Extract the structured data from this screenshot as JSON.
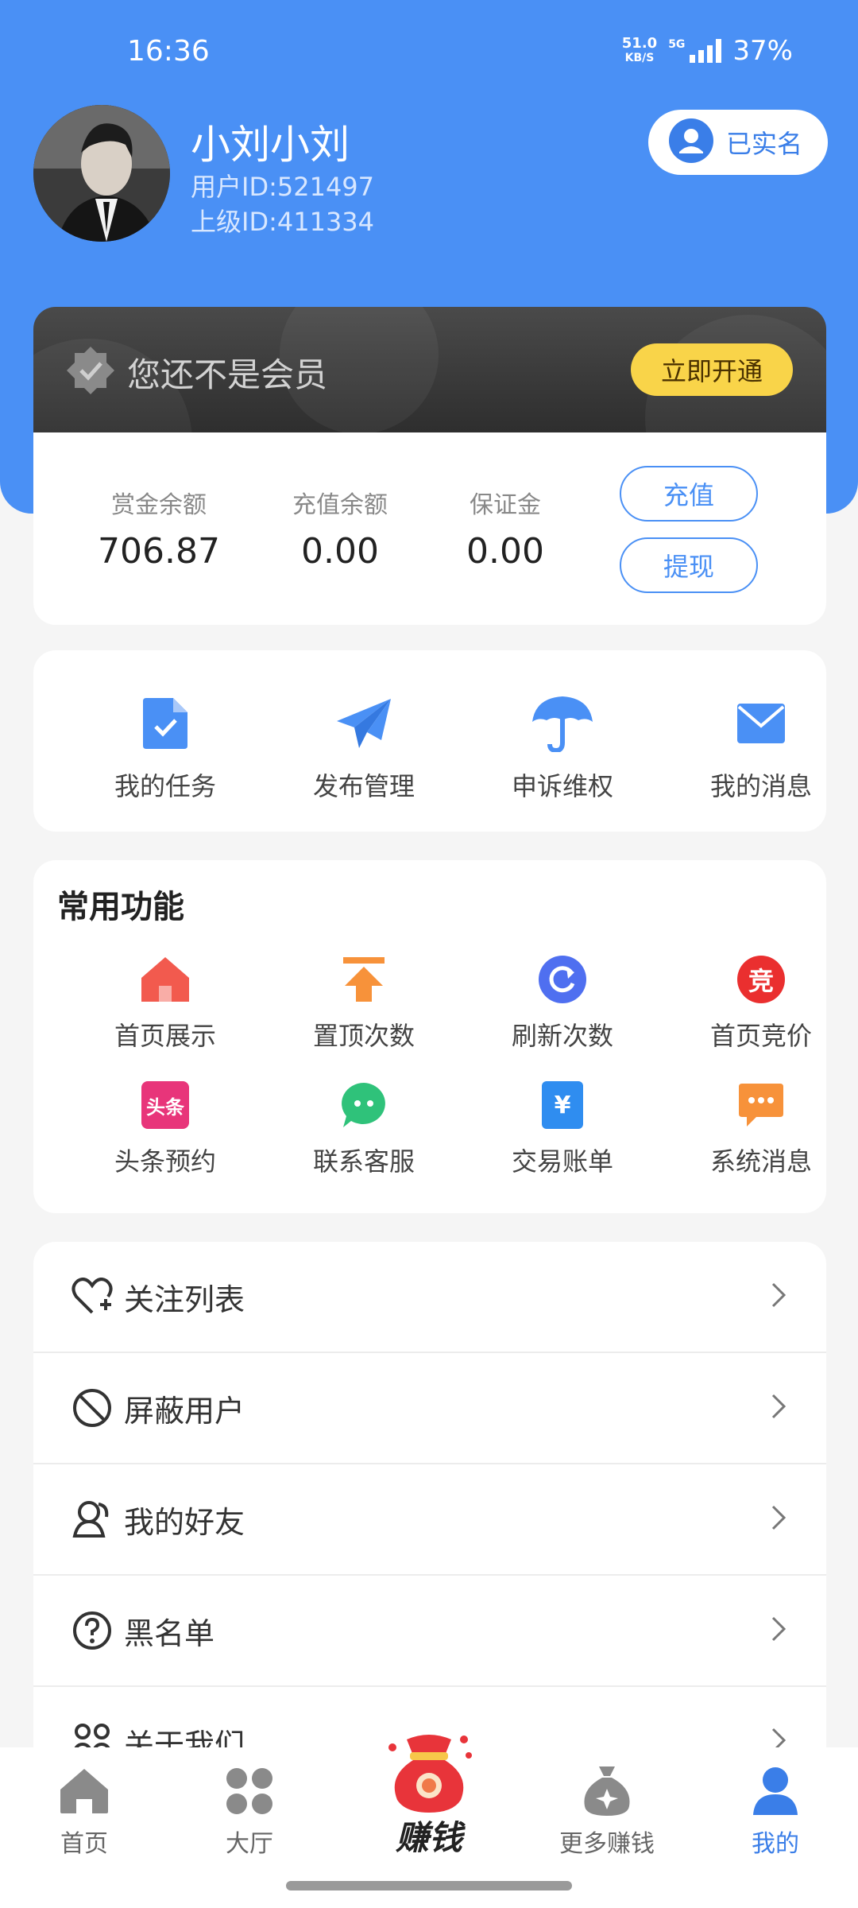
{
  "status": {
    "time": "16:36",
    "net_speed_top": "51.0",
    "net_speed_unit": "KB/S",
    "network": "5G",
    "battery": "37%"
  },
  "profile": {
    "name": "小刘小刘",
    "user_id": "用户ID:521497",
    "parent_id": "上级ID:411334",
    "verified_label": "已实名"
  },
  "member": {
    "text": "您还不是会员",
    "open_label": "立即开通"
  },
  "balance": {
    "items": [
      {
        "label": "赏金余额",
        "value": "706.87"
      },
      {
        "label": "充值余额",
        "value": "0.00"
      },
      {
        "label": "保证金",
        "value": "0.00"
      }
    ],
    "recharge_label": "充值",
    "withdraw_label": "提现"
  },
  "quick": [
    {
      "label": "我的任务",
      "icon": "task-doc-icon"
    },
    {
      "label": "发布管理",
      "icon": "paper-plane-icon"
    },
    {
      "label": "申诉维权",
      "icon": "umbrella-icon"
    },
    {
      "label": "我的消息",
      "icon": "mail-icon"
    }
  ],
  "functions": {
    "title": "常用功能",
    "items": [
      {
        "label": "首页展示",
        "icon": "home-icon"
      },
      {
        "label": "置顶次数",
        "icon": "pin-top-icon"
      },
      {
        "label": "刷新次数",
        "icon": "refresh-icon"
      },
      {
        "label": "首页竞价",
        "icon": "bid-icon",
        "glyph": "竞"
      },
      {
        "label": "头条预约",
        "icon": "headline-icon",
        "glyph": "头条"
      },
      {
        "label": "联系客服",
        "icon": "chat-icon"
      },
      {
        "label": "交易账单",
        "icon": "bill-icon",
        "glyph": "¥"
      },
      {
        "label": "系统消息",
        "icon": "system-message-icon"
      }
    ]
  },
  "menu": [
    {
      "label": "关注列表",
      "icon": "heart-plus-icon"
    },
    {
      "label": "屏蔽用户",
      "icon": "block-icon"
    },
    {
      "label": "我的好友",
      "icon": "friends-icon"
    },
    {
      "label": "黑名单",
      "icon": "question-icon"
    },
    {
      "label": "关于我们",
      "icon": "about-icon"
    }
  ],
  "nav": [
    {
      "label": "首页",
      "icon": "home-nav-icon"
    },
    {
      "label": "大厅",
      "icon": "grid-icon"
    },
    {
      "label": "赚钱",
      "icon": "money-bag-icon"
    },
    {
      "label": "更多赚钱",
      "icon": "coin-bag-icon"
    },
    {
      "label": "我的",
      "icon": "person-icon"
    }
  ],
  "colors": {
    "primary": "#4a90f5",
    "member_gold": "#f9d449",
    "active_nav": "#3a7ee8"
  }
}
